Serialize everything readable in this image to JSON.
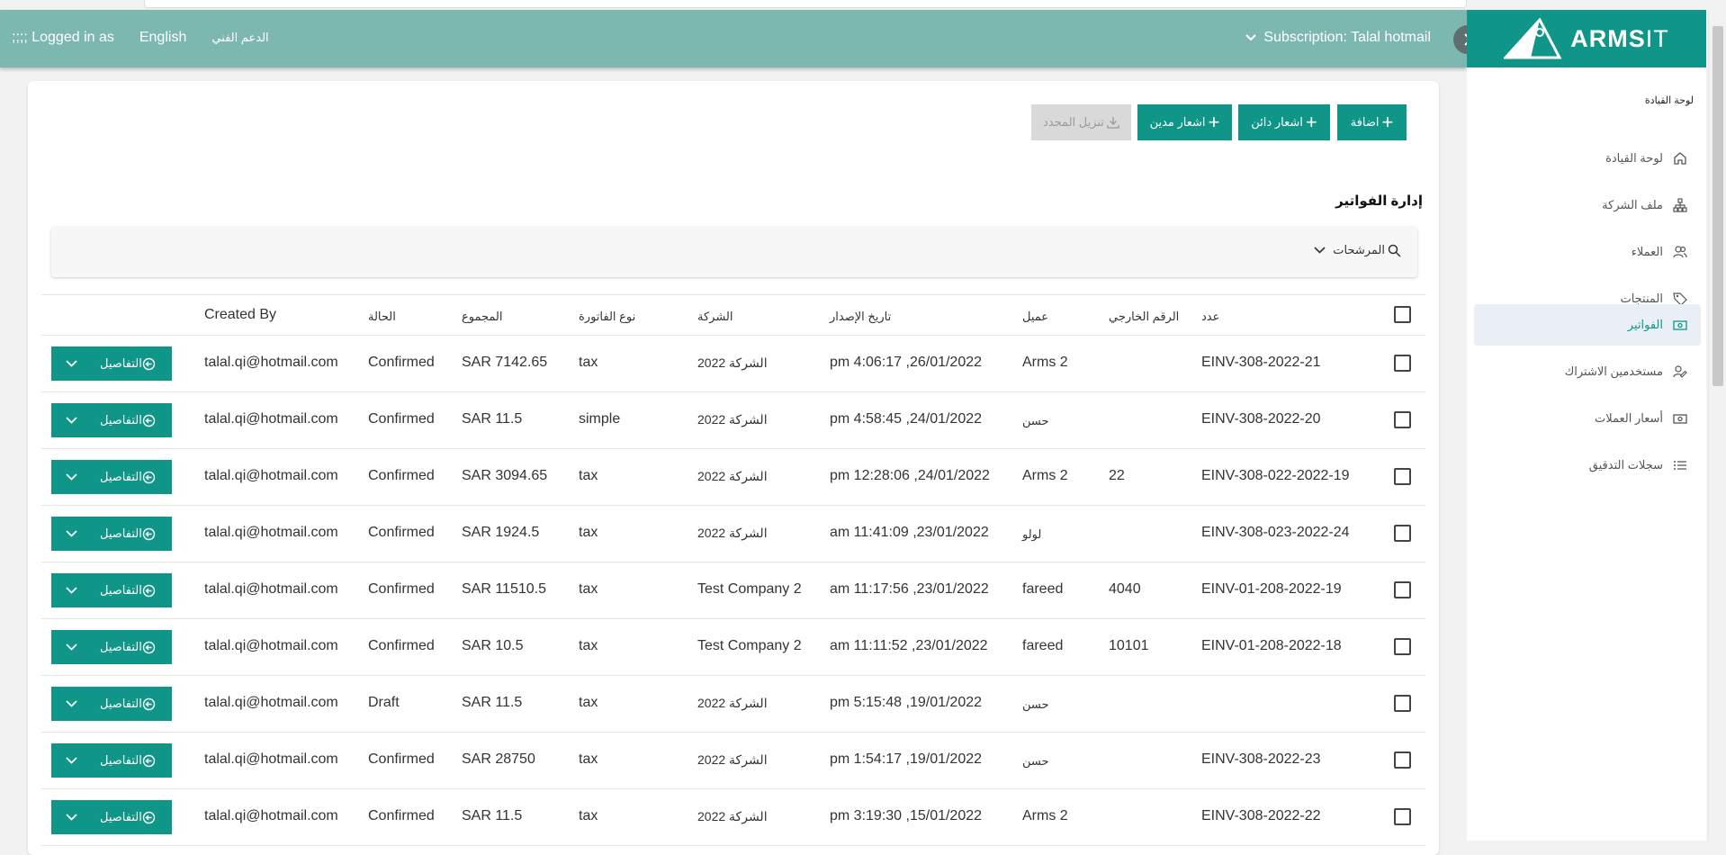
{
  "header": {
    "logged_in": ";;;; Logged in as",
    "language": "English",
    "support": "الدعم الفني",
    "subscription": "Subscription: Talal hotmail"
  },
  "brand": {
    "logo_main": "ARMS",
    "logo_it": "IT"
  },
  "sidebar": {
    "section_title": "لوحة القيادة",
    "items": [
      {
        "label": "لوحة القيادة",
        "icon": "home-icon"
      },
      {
        "label": "ملف الشركة",
        "icon": "org-chart-icon"
      },
      {
        "label": "العملاء",
        "icon": "users-icon"
      },
      {
        "label": "المنتجات",
        "icon": "tag-icon"
      },
      {
        "label": "الفواتير",
        "icon": "money-icon"
      },
      {
        "label": "مستخدمين الاشتراك",
        "icon": "user-edit-icon"
      },
      {
        "label": "أسعار العملات",
        "icon": "money-icon"
      },
      {
        "label": "سجلات التدقيق",
        "icon": "list-icon"
      }
    ]
  },
  "toolbar": {
    "add": "اضافة",
    "credit_note": "اشعار دائن",
    "debit_note": "اشعار مدين",
    "download_selected": "تنزيل المحدد"
  },
  "page": {
    "title": "إدارة الفواتير",
    "filters": "المرشحات"
  },
  "table": {
    "headers": {
      "number": "عدد",
      "external_no": "الرقم الخارجي",
      "customer": "عميل",
      "issue_date": "تاريخ الإصدار",
      "company": "الشركة",
      "invoice_type": "نوع الفاتورة",
      "total": "المجموع",
      "status": "الحالة",
      "created_by": "Created By"
    },
    "details_label": "التفاصيل",
    "rows": [
      {
        "number": "EINV-308-2022-21",
        "external_no": "",
        "customer": "Arms 2",
        "issue_date": "pm 4:06:17 ,26/01/2022",
        "company": "الشركة 2022",
        "type": "tax",
        "total": "SAR 7142.65",
        "status": "Confirmed",
        "created_by": "talal.qi@hotmail.com"
      },
      {
        "number": "EINV-308-2022-20",
        "external_no": "",
        "customer": "حسن",
        "issue_date": "pm 4:58:45 ,24/01/2022",
        "company": "الشركة 2022",
        "type": "simple",
        "total": "SAR 11.5",
        "status": "Confirmed",
        "created_by": "talal.qi@hotmail.com"
      },
      {
        "number": "EINV-308-022-2022-19",
        "external_no": "22",
        "customer": "Arms 2",
        "issue_date": "pm 12:28:06 ,24/01/2022",
        "company": "الشركة 2022",
        "type": "tax",
        "total": "SAR 3094.65",
        "status": "Confirmed",
        "created_by": "talal.qi@hotmail.com"
      },
      {
        "number": "EINV-308-023-2022-24",
        "external_no": "",
        "customer": "لولو",
        "issue_date": "am 11:41:09 ,23/01/2022",
        "company": "الشركة 2022",
        "type": "tax",
        "total": "SAR 1924.5",
        "status": "Confirmed",
        "created_by": "talal.qi@hotmail.com"
      },
      {
        "number": "EINV-01-208-2022-19",
        "external_no": "4040",
        "customer": "fareed",
        "issue_date": "am 11:17:56 ,23/01/2022",
        "company": "Test Company 2",
        "type": "tax",
        "total": "SAR 11510.5",
        "status": "Confirmed",
        "created_by": "talal.qi@hotmail.com"
      },
      {
        "number": "EINV-01-208-2022-18",
        "external_no": "10101",
        "customer": "fareed",
        "issue_date": "am 11:11:52 ,23/01/2022",
        "company": "Test Company 2",
        "type": "tax",
        "total": "SAR 10.5",
        "status": "Confirmed",
        "created_by": "talal.qi@hotmail.com"
      },
      {
        "number": "",
        "external_no": "",
        "customer": "حسن",
        "issue_date": "pm 5:15:48 ,19/01/2022",
        "company": "الشركة 2022",
        "type": "tax",
        "total": "SAR 11.5",
        "status": "Draft",
        "created_by": "talal.qi@hotmail.com"
      },
      {
        "number": "EINV-308-2022-23",
        "external_no": "",
        "customer": "حسن",
        "issue_date": "pm 1:54:17 ,19/01/2022",
        "company": "الشركة 2022",
        "type": "tax",
        "total": "SAR 28750",
        "status": "Confirmed",
        "created_by": "talal.qi@hotmail.com"
      },
      {
        "number": "EINV-308-2022-22",
        "external_no": "",
        "customer": "Arms 2",
        "issue_date": "pm 3:19:30 ,15/01/2022",
        "company": "الشركة 2022",
        "type": "tax",
        "total": "SAR 11.5",
        "status": "Confirmed",
        "created_by": "talal.qi@hotmail.com"
      }
    ]
  },
  "colors": {
    "accent": "#0f9688",
    "header": "#7db8b0",
    "active_bg": "#eaeef5"
  }
}
